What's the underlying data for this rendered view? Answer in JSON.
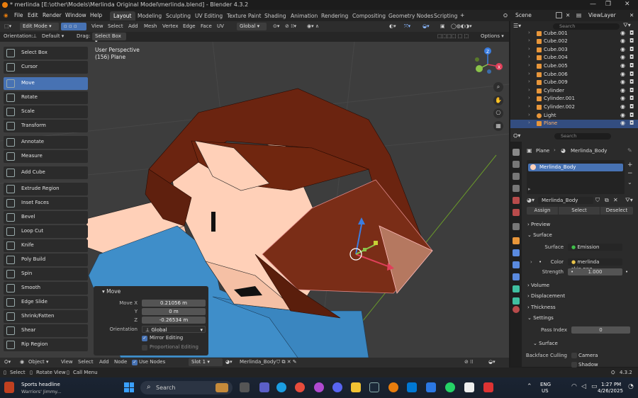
{
  "window": {
    "title": "* merlinda [E:\\other\\Models\\Merlinda Original Model\\merlinda.blend] - Blender 4.3.2"
  },
  "menu": {
    "items": [
      "File",
      "Edit",
      "Render",
      "Window",
      "Help"
    ],
    "workspaces": [
      "Layout",
      "Modeling",
      "Sculpting",
      "UV Editing",
      "Texture Paint",
      "Shading",
      "Animation",
      "Rendering",
      "Compositing",
      "Geometry Nodes",
      "Scripting"
    ],
    "active_workspace": "Layout",
    "add_tab": "+",
    "scene_label": "Scene",
    "viewlayer_label": "ViewLayer"
  },
  "viewport_header": {
    "mode": "Edit Mode",
    "menus": [
      "View",
      "Select",
      "Add",
      "Mesh",
      "Vertex",
      "Edge",
      "Face",
      "UV"
    ],
    "transform_orientation": "Global",
    "orientation_label": "Orientation:",
    "orientation_value": "Default",
    "drag_label": "Drag:",
    "drag_value": "Select Box",
    "options_label": "Options"
  },
  "overlay": {
    "perspective": "User Perspective",
    "object_info": "(156) Plane"
  },
  "tools": [
    {
      "label": "Select Box",
      "icon": "select-box-icon",
      "active": false
    },
    {
      "label": "Cursor",
      "icon": "cursor-icon",
      "active": false
    },
    {
      "label": "Move",
      "icon": "move-icon",
      "active": true
    },
    {
      "label": "Rotate",
      "icon": "rotate-icon",
      "active": false
    },
    {
      "label": "Scale",
      "icon": "scale-icon",
      "active": false
    },
    {
      "label": "Transform",
      "icon": "transform-icon",
      "active": false
    },
    {
      "label": "Annotate",
      "icon": "annotate-icon",
      "active": false
    },
    {
      "label": "Measure",
      "icon": "measure-icon",
      "active": false
    },
    {
      "label": "Add Cube",
      "icon": "add-cube-icon",
      "active": false
    },
    {
      "label": "Extrude Region",
      "icon": "extrude-icon",
      "active": false
    },
    {
      "label": "Inset Faces",
      "icon": "inset-icon",
      "active": false
    },
    {
      "label": "Bevel",
      "icon": "bevel-icon",
      "active": false
    },
    {
      "label": "Loop Cut",
      "icon": "loop-cut-icon",
      "active": false
    },
    {
      "label": "Knife",
      "icon": "knife-icon",
      "active": false
    },
    {
      "label": "Poly Build",
      "icon": "poly-build-icon",
      "active": false
    },
    {
      "label": "Spin",
      "icon": "spin-icon",
      "active": false
    },
    {
      "label": "Smooth",
      "icon": "smooth-icon",
      "active": false
    },
    {
      "label": "Edge Slide",
      "icon": "edge-slide-icon",
      "active": false
    },
    {
      "label": "Shrink/Fatten",
      "icon": "shrink-fatten-icon",
      "active": false
    },
    {
      "label": "Shear",
      "icon": "shear-icon",
      "active": false
    },
    {
      "label": "Rip Region",
      "icon": "rip-icon",
      "active": false
    }
  ],
  "redo_panel": {
    "title": "Move",
    "move_x_label": "Move X",
    "move_x": "0.21056 m",
    "y_label": "Y",
    "y": "0 m",
    "z_label": "Z",
    "z": "-0.26534 m",
    "orientation_label": "Orientation",
    "orientation": "Global",
    "mirror_editing": "Mirror Editing",
    "proportional_editing": "Proportional Editing"
  },
  "outliner": {
    "search_placeholder": "Search",
    "items": [
      {
        "name": "Cube.001",
        "selected": false
      },
      {
        "name": "Cube.002",
        "selected": false
      },
      {
        "name": "Cube.003",
        "selected": false
      },
      {
        "name": "Cube.004",
        "selected": false
      },
      {
        "name": "Cube.005",
        "selected": false
      },
      {
        "name": "Cube.006",
        "selected": false
      },
      {
        "name": "Cube.009",
        "selected": false
      },
      {
        "name": "Cylinder",
        "selected": false
      },
      {
        "name": "Cylinder.001",
        "selected": false
      },
      {
        "name": "Cylinder.002",
        "selected": false
      },
      {
        "name": "Light",
        "selected": false
      },
      {
        "name": "Plane",
        "selected": true
      }
    ]
  },
  "properties": {
    "search_placeholder": "Search",
    "object_name": "Plane",
    "material_name": "Merlinda_Body",
    "slot_material": "Merlinda_Body",
    "assign": "Assign",
    "select": "Select",
    "deselect": "Deselect",
    "sections": {
      "preview": "Preview",
      "surface": "Surface",
      "volume": "Volume",
      "displacement": "Displacement",
      "thickness": "Thickness",
      "settings": "Settings",
      "surface_sub": "Surface"
    },
    "surface_label": "Surface",
    "surface_value": "Emission",
    "color_label": "Color",
    "color_value": "merlinda skin.png...",
    "strength_label": "Strength",
    "strength_value": "1.000",
    "pass_index_label": "Pass Index",
    "pass_index_value": "0",
    "backface_culling_label": "Backface Culling",
    "camera_label": "Camera",
    "shadow_label": "Shadow"
  },
  "viewport_bottom": {
    "editor": "Object",
    "menus": [
      "View",
      "Select",
      "Add",
      "Node"
    ],
    "use_nodes": "Use Nodes",
    "slot": "Slot 1",
    "material": "Merlinda_Body"
  },
  "statusbar": {
    "select": "Select",
    "rotate_view": "Rotate View",
    "call_menu": "Call Menu",
    "version": "4.3.2"
  },
  "taskbar": {
    "news_title": "Sports headline",
    "news_sub": "Warriors' Jimmy...",
    "search_placeholder": "Search",
    "lang": "ENG",
    "region": "US",
    "time": "1:27 PM",
    "date": "4/26/2025"
  },
  "colors": {
    "accent": "#4772b3",
    "hair": "#6b2410",
    "skin": "#ffd0b8",
    "shirt": "#3f8ec9"
  }
}
